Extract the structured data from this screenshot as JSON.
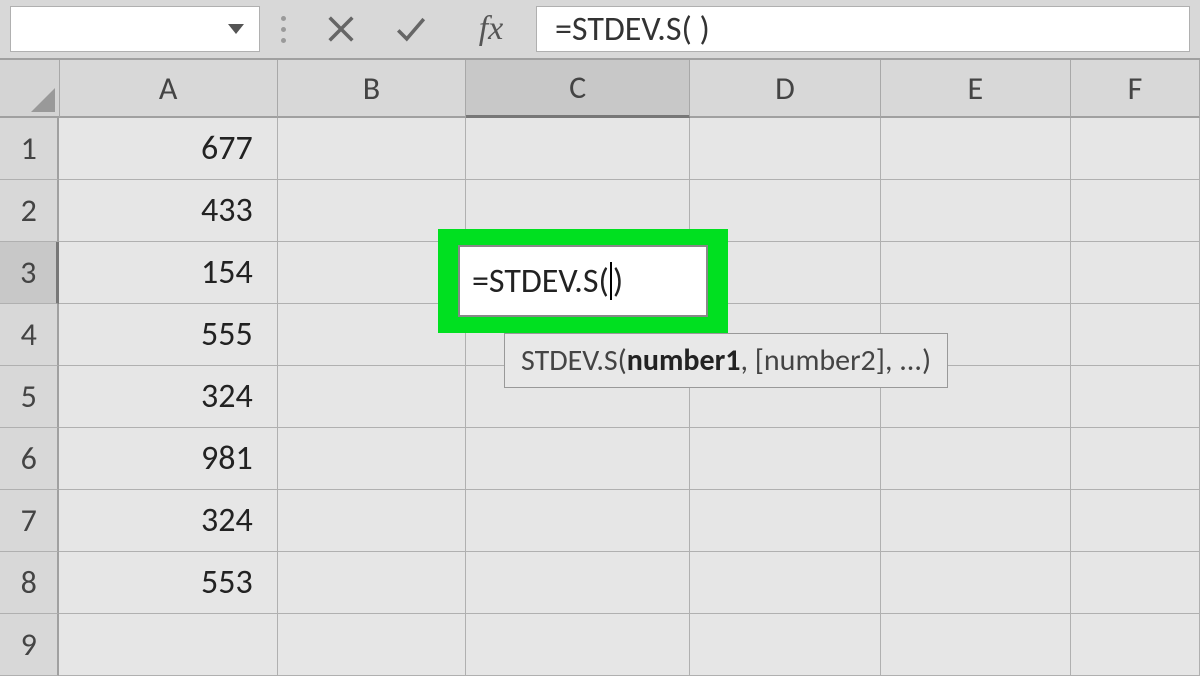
{
  "formula_bar": {
    "name_box_value": "",
    "fx_label": "fx",
    "formula_text": "=STDEV.S( )"
  },
  "columns": [
    "A",
    "B",
    "C",
    "D",
    "E",
    "F"
  ],
  "active_column": "C",
  "rows": [
    {
      "num": "1",
      "a": "677"
    },
    {
      "num": "2",
      "a": "433"
    },
    {
      "num": "3",
      "a": "154"
    },
    {
      "num": "4",
      "a": "555"
    },
    {
      "num": "5",
      "a": "324"
    },
    {
      "num": "6",
      "a": "981"
    },
    {
      "num": "7",
      "a": "324"
    },
    {
      "num": "8",
      "a": "553"
    },
    {
      "num": "9",
      "a": ""
    }
  ],
  "active_row": "3",
  "editing_cell": {
    "text_before_cursor": "=STDEV.S(",
    "text_after_cursor": ")"
  },
  "tooltip": {
    "func": "STDEV.S(",
    "arg1": "number1",
    "rest": ", [number2], ...)"
  }
}
